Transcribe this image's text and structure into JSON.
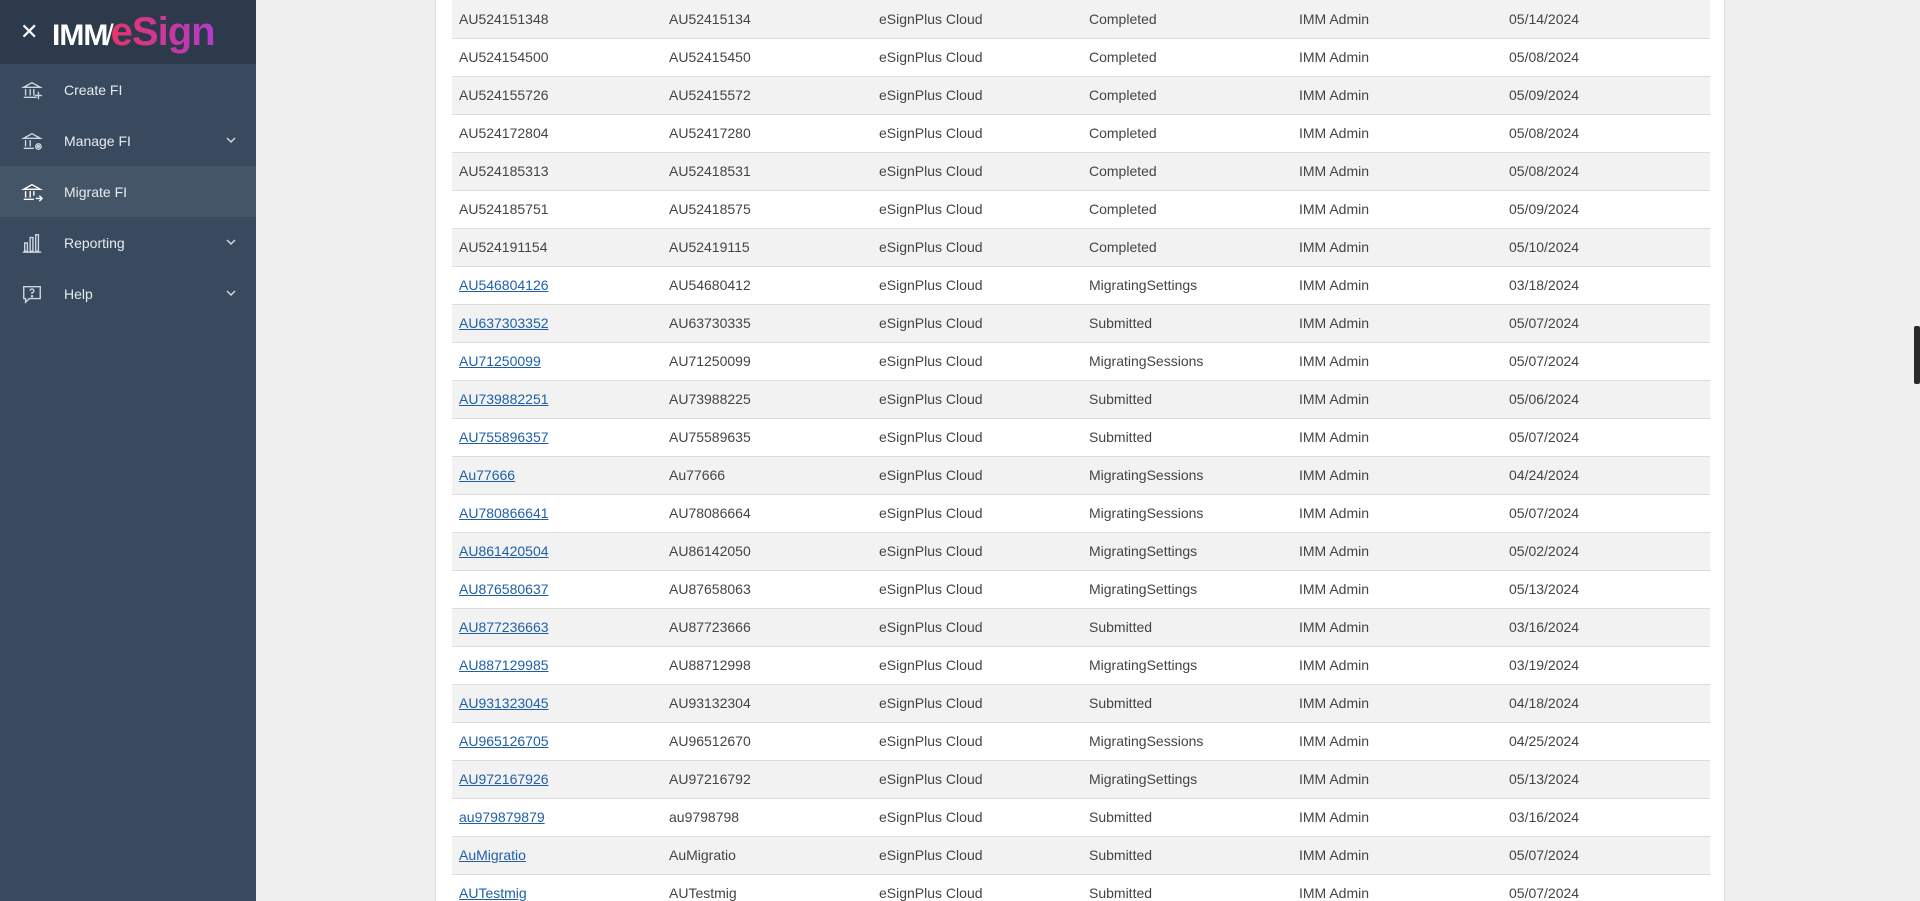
{
  "brand": {
    "prefix": "IMM",
    "slash": "/",
    "name": "eSign"
  },
  "nav": [
    {
      "label": "Create FI",
      "icon": "bank-add-icon",
      "expandable": false,
      "active": false
    },
    {
      "label": "Manage FI",
      "icon": "bank-settings-icon",
      "expandable": true,
      "active": false
    },
    {
      "label": "Migrate FI",
      "icon": "bank-migrate-icon",
      "expandable": false,
      "active": true
    },
    {
      "label": "Reporting",
      "icon": "bar-chart-icon",
      "expandable": true,
      "active": false
    },
    {
      "label": "Help",
      "icon": "help-icon",
      "expandable": true,
      "active": false
    }
  ],
  "colors": {
    "sidebar": "#3a4a5e",
    "sidebar_header": "#2d3a4b",
    "link": "#1f5fa8",
    "brand_pink": "#e8336b",
    "brand_purple": "#b03cc8"
  },
  "rows": [
    {
      "id": "AU524151348",
      "link": false,
      "code": "AU52415134",
      "platform": "eSignPlus Cloud",
      "status": "Completed",
      "user": "IMM Admin",
      "date": "05/14/2024"
    },
    {
      "id": "AU524154500",
      "link": false,
      "code": "AU52415450",
      "platform": "eSignPlus Cloud",
      "status": "Completed",
      "user": "IMM Admin",
      "date": "05/08/2024"
    },
    {
      "id": "AU524155726",
      "link": false,
      "code": "AU52415572",
      "platform": "eSignPlus Cloud",
      "status": "Completed",
      "user": "IMM Admin",
      "date": "05/09/2024"
    },
    {
      "id": "AU524172804",
      "link": false,
      "code": "AU52417280",
      "platform": "eSignPlus Cloud",
      "status": "Completed",
      "user": "IMM Admin",
      "date": "05/08/2024"
    },
    {
      "id": "AU524185313",
      "link": false,
      "code": "AU52418531",
      "platform": "eSignPlus Cloud",
      "status": "Completed",
      "user": "IMM Admin",
      "date": "05/08/2024"
    },
    {
      "id": "AU524185751",
      "link": false,
      "code": "AU52418575",
      "platform": "eSignPlus Cloud",
      "status": "Completed",
      "user": "IMM Admin",
      "date": "05/09/2024"
    },
    {
      "id": "AU524191154",
      "link": false,
      "code": "AU52419115",
      "platform": "eSignPlus Cloud",
      "status": "Completed",
      "user": "IMM Admin",
      "date": "05/10/2024"
    },
    {
      "id": "AU546804126",
      "link": true,
      "code": "AU54680412",
      "platform": "eSignPlus Cloud",
      "status": "MigratingSettings",
      "user": "IMM Admin",
      "date": "03/18/2024"
    },
    {
      "id": "AU637303352",
      "link": true,
      "code": "AU63730335",
      "platform": "eSignPlus Cloud",
      "status": "Submitted",
      "user": "IMM Admin",
      "date": "05/07/2024"
    },
    {
      "id": "AU71250099",
      "link": true,
      "code": "AU71250099",
      "platform": "eSignPlus Cloud",
      "status": "MigratingSessions",
      "user": "IMM Admin",
      "date": "05/07/2024"
    },
    {
      "id": "AU739882251",
      "link": true,
      "code": "AU73988225",
      "platform": "eSignPlus Cloud",
      "status": "Submitted",
      "user": "IMM Admin",
      "date": "05/06/2024"
    },
    {
      "id": "AU755896357",
      "link": true,
      "code": "AU75589635",
      "platform": "eSignPlus Cloud",
      "status": "Submitted",
      "user": "IMM Admin",
      "date": "05/07/2024"
    },
    {
      "id": "Au77666",
      "link": true,
      "code": "Au77666",
      "platform": "eSignPlus Cloud",
      "status": "MigratingSessions",
      "user": "IMM Admin",
      "date": "04/24/2024"
    },
    {
      "id": "AU780866641",
      "link": true,
      "code": "AU78086664",
      "platform": "eSignPlus Cloud",
      "status": "MigratingSessions",
      "user": "IMM Admin",
      "date": "05/07/2024"
    },
    {
      "id": "AU861420504",
      "link": true,
      "code": "AU86142050",
      "platform": "eSignPlus Cloud",
      "status": "MigratingSettings",
      "user": "IMM Admin",
      "date": "05/02/2024"
    },
    {
      "id": "AU876580637",
      "link": true,
      "code": "AU87658063",
      "platform": "eSignPlus Cloud",
      "status": "MigratingSettings",
      "user": "IMM Admin",
      "date": "05/13/2024"
    },
    {
      "id": "AU877236663",
      "link": true,
      "code": "AU87723666",
      "platform": "eSignPlus Cloud",
      "status": "Submitted",
      "user": "IMM Admin",
      "date": "03/16/2024"
    },
    {
      "id": "AU887129985",
      "link": true,
      "code": "AU88712998",
      "platform": "eSignPlus Cloud",
      "status": "MigratingSettings",
      "user": "IMM Admin",
      "date": "03/19/2024"
    },
    {
      "id": "AU931323045",
      "link": true,
      "code": "AU93132304",
      "platform": "eSignPlus Cloud",
      "status": "Submitted",
      "user": "IMM Admin",
      "date": "04/18/2024"
    },
    {
      "id": "AU965126705",
      "link": true,
      "code": "AU96512670",
      "platform": "eSignPlus Cloud",
      "status": "MigratingSessions",
      "user": "IMM Admin",
      "date": "04/25/2024"
    },
    {
      "id": "AU972167926",
      "link": true,
      "code": "AU97216792",
      "platform": "eSignPlus Cloud",
      "status": "MigratingSettings",
      "user": "IMM Admin",
      "date": "05/13/2024"
    },
    {
      "id": "au979879879",
      "link": true,
      "code": "au9798798",
      "platform": "eSignPlus Cloud",
      "status": "Submitted",
      "user": "IMM Admin",
      "date": "03/16/2024"
    },
    {
      "id": "AuMigratio",
      "link": true,
      "code": "AuMigratio",
      "platform": "eSignPlus Cloud",
      "status": "Submitted",
      "user": "IMM Admin",
      "date": "05/07/2024"
    },
    {
      "id": "AUTestmig",
      "link": true,
      "code": "AUTestmig",
      "platform": "eSignPlus Cloud",
      "status": "Submitted",
      "user": "IMM Admin",
      "date": "05/07/2024"
    }
  ]
}
